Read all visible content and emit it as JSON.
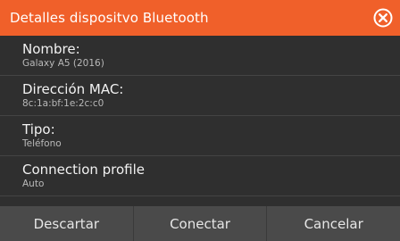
{
  "dialog": {
    "title": "Detalles dispositvo Bluetooth",
    "close_icon": "close-circle-icon",
    "accent_color": "#f0602a"
  },
  "rows": [
    {
      "label": "Nombre:",
      "value": "Galaxy A5 (2016)"
    },
    {
      "label": "Dirección MAC:",
      "value": "8c:1a:bf:1e:2c:c0"
    },
    {
      "label": "Tipo:",
      "value": "Teléfono"
    },
    {
      "label": "Connection profile",
      "value": "Auto"
    }
  ],
  "buttons": {
    "discard": "Descartar",
    "connect": "Conectar",
    "cancel": "Cancelar"
  }
}
